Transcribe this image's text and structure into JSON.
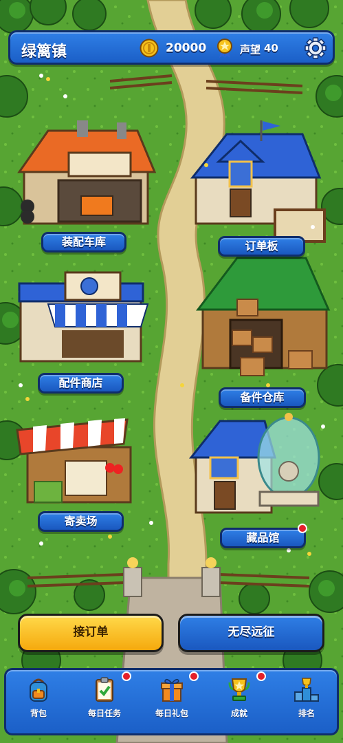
{
  "header": {
    "town_name": "绿篱镇",
    "coins": "20000",
    "reputation_label": "声望",
    "reputation_value": "40"
  },
  "buildings": [
    {
      "label": "装配车库",
      "notification": false
    },
    {
      "label": "订单板",
      "notification": false
    },
    {
      "label": "配件商店",
      "notification": false
    },
    {
      "label": "备件仓库",
      "notification": false
    },
    {
      "label": "寄卖场",
      "notification": false
    },
    {
      "label": "藏品馆",
      "notification": true
    }
  ],
  "actions": {
    "accept_order": "接订单",
    "endless_expedition": "无尽远征"
  },
  "bottom_nav": [
    {
      "label": "背包",
      "icon": "backpack-icon",
      "notification": false
    },
    {
      "label": "每日任务",
      "icon": "clipboard-check-icon",
      "notification": true
    },
    {
      "label": "每日礼包",
      "icon": "gift-icon",
      "notification": true
    },
    {
      "label": "成就",
      "icon": "trophy-icon",
      "notification": true
    },
    {
      "label": "排名",
      "icon": "podium-icon",
      "notification": false
    }
  ],
  "colors": {
    "ui_blue": "#1f6ad6",
    "button_yellow": "#f7c21e",
    "notification_red": "#e4202a",
    "grass": "#4f9a2e"
  }
}
